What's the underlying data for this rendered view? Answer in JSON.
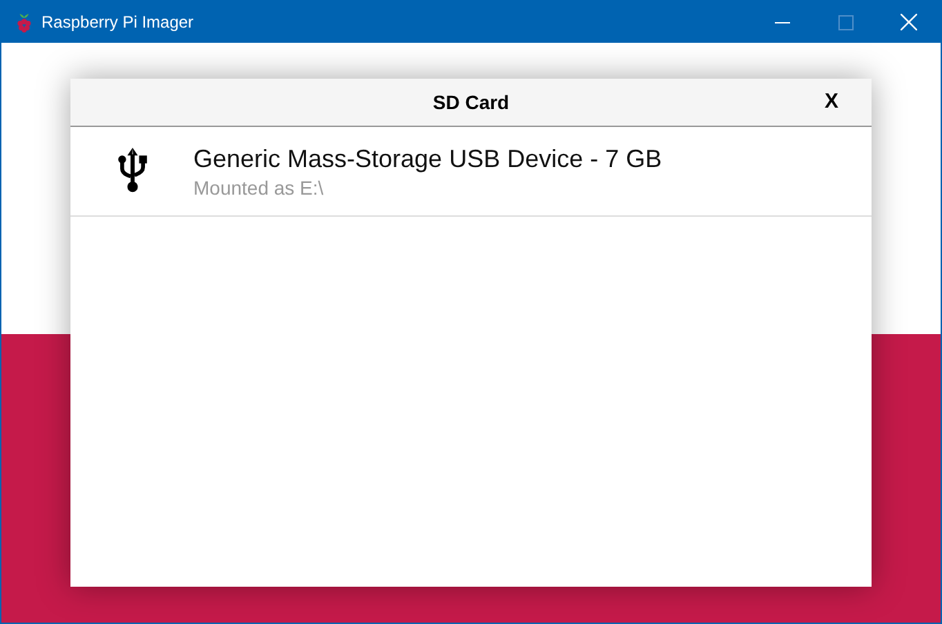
{
  "window": {
    "title": "Raspberry Pi Imager"
  },
  "dialog": {
    "title": "SD Card",
    "close": "X",
    "devices": [
      {
        "name": "Generic Mass-Storage USB Device - 7 GB",
        "detail": "Mounted as E:\\"
      }
    ]
  }
}
